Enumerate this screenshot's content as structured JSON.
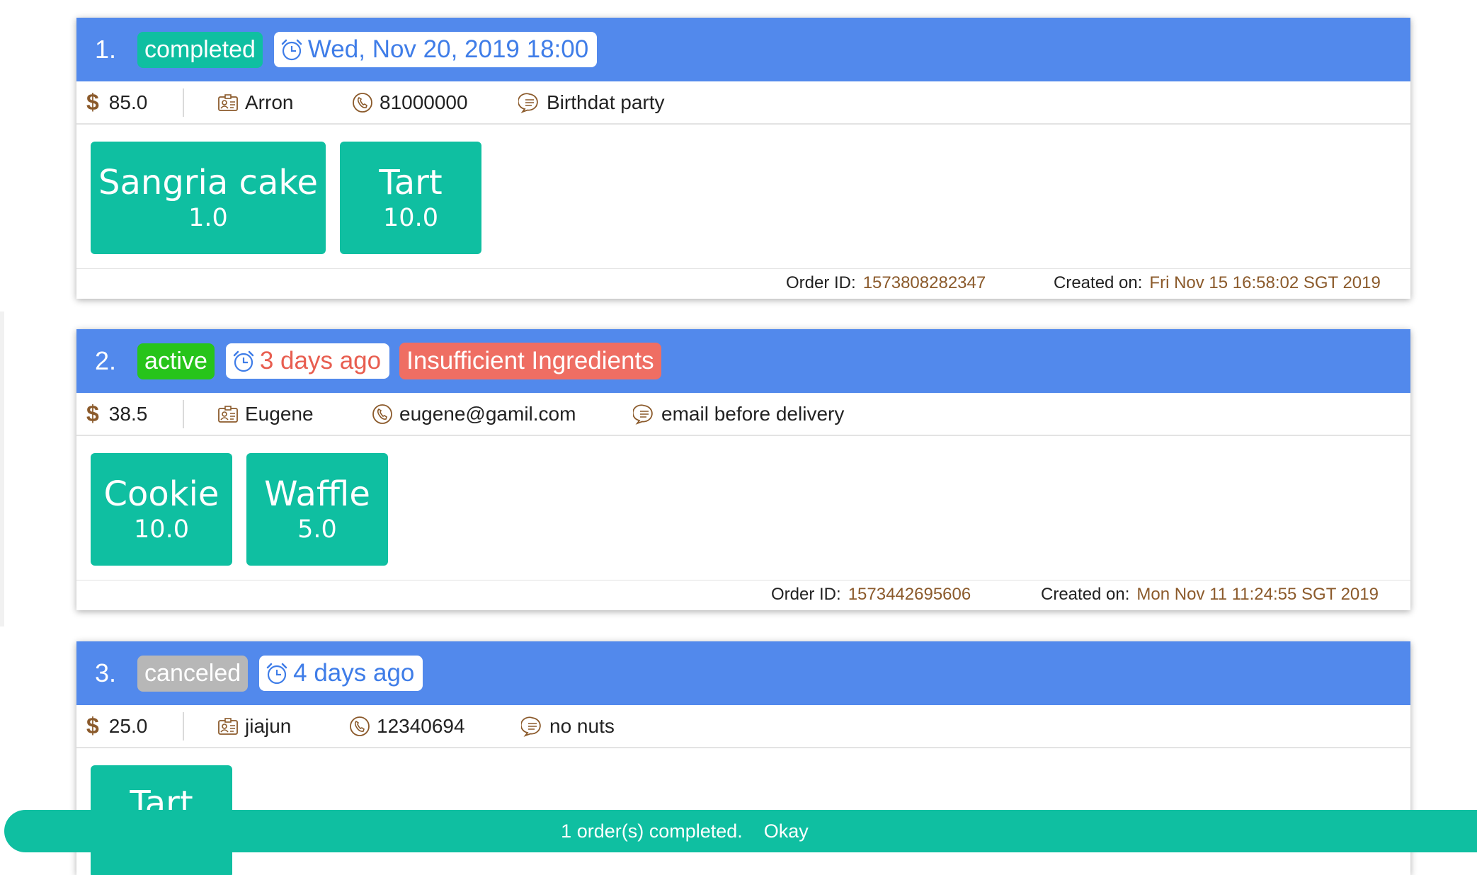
{
  "orders": [
    {
      "index": "1.",
      "status": "completed",
      "date": "Wed, Nov 20, 2019 18:00",
      "price": "85.0",
      "customer": "Arron",
      "contact": "81000000",
      "remarks": "Birthdat party",
      "items": [
        {
          "name": "Sangria cake",
          "qty": "1.0"
        },
        {
          "name": "Tart",
          "qty": "10.0"
        }
      ],
      "order_id_label": "Order ID:",
      "order_id": "1573808282347",
      "created_label": "Created on:",
      "created": "Fri Nov 15 16:58:02 SGT 2019"
    },
    {
      "index": "2.",
      "status": "active",
      "date": "3 days ago",
      "warning": "Insufficient Ingredients",
      "price": "38.5",
      "customer": "Eugene",
      "contact": "eugene@gamil.com",
      "remarks": "email before delivery",
      "items": [
        {
          "name": "Cookie",
          "qty": "10.0"
        },
        {
          "name": "Waffle",
          "qty": "5.0"
        }
      ],
      "order_id_label": "Order ID:",
      "order_id": "1573442695606",
      "created_label": "Created on:",
      "created": "Mon Nov 11 11:24:55 SGT 2019"
    },
    {
      "index": "3.",
      "status": "canceled",
      "date": "4 days ago",
      "price": "25.0",
      "customer": "jiajun",
      "contact": "12340694",
      "remarks": "no nuts",
      "items": [
        {
          "name": "Tart",
          "qty": ""
        }
      ]
    }
  ],
  "snackbar": {
    "message": "1 order(s) completed.",
    "action": "Okay"
  },
  "colors": {
    "header": "#5289EC",
    "completed": "#0FBFA1",
    "active": "#27C41A",
    "canceled": "#B7B7B7",
    "warning": "#EF6E63",
    "item_tile": "#0FBFA1",
    "date_text": "#3F7DE8",
    "overdue_text": "#E85E50",
    "meta_value": "#8B5A2B"
  },
  "icons": [
    "dollar-icon",
    "id-card-icon",
    "phone-icon",
    "chat-icon",
    "alarm-clock-icon"
  ]
}
